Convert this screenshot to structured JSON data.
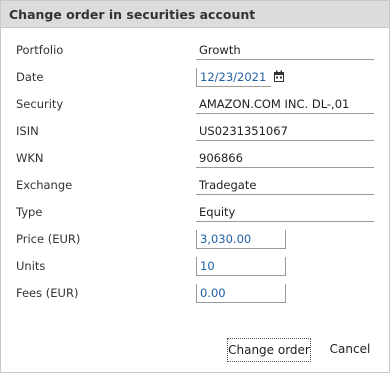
{
  "dialog": {
    "title": "Change order in securities account"
  },
  "fields": {
    "portfolio": {
      "label": "Portfolio",
      "value": "Growth"
    },
    "date": {
      "label": "Date",
      "value": "12/23/2021"
    },
    "security": {
      "label": "Security",
      "value": "AMAZON.COM INC. DL-,01"
    },
    "isin": {
      "label": "ISIN",
      "value": "US0231351067"
    },
    "wkn": {
      "label": "WKN",
      "value": "906866"
    },
    "exchange": {
      "label": "Exchange",
      "value": "Tradegate"
    },
    "type": {
      "label": "Type",
      "value": "Equity"
    },
    "price": {
      "label": "Price (EUR)",
      "value": "3,030.00"
    },
    "units": {
      "label": "Units",
      "value": "10"
    },
    "fees": {
      "label": "Fees (EUR)",
      "value": "0.00"
    }
  },
  "buttons": {
    "change_order": "Change order",
    "cancel": "Cancel"
  },
  "colors": {
    "title_bg": "#dcdcdc",
    "input_text": "#1f5fa5"
  },
  "icons": {
    "date_picker": "calendar-icon"
  }
}
